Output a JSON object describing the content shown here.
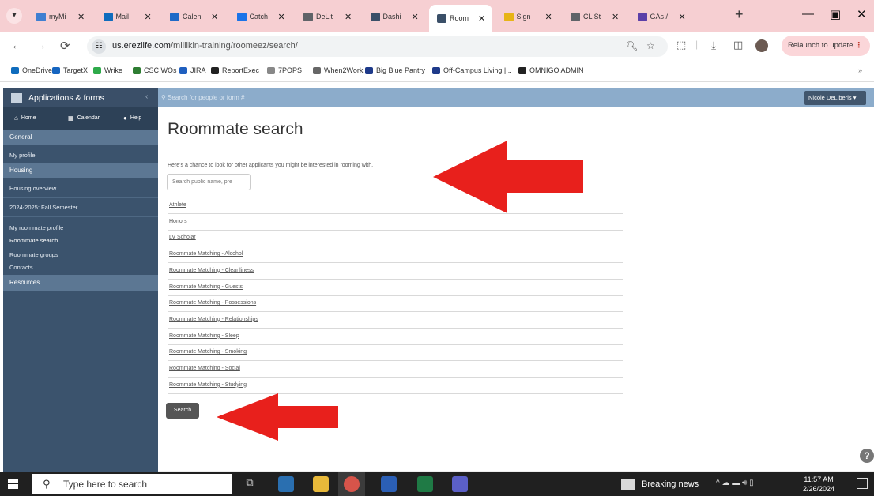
{
  "browser": {
    "tabs": [
      {
        "title": "myMi",
        "color": "#3f7fd1"
      },
      {
        "title": "Mail",
        "color": "#0f6cbd"
      },
      {
        "title": "Calen",
        "color": "#1e69c7"
      },
      {
        "title": "Catch",
        "color": "#1a73e8"
      },
      {
        "title": "DeLit",
        "color": "#5f6368"
      },
      {
        "title": "Dashi",
        "color": "#3a4f68"
      },
      {
        "title": "Room",
        "color": "#3a4f68",
        "active": true
      },
      {
        "title": "Sign",
        "color": "#e7b416"
      },
      {
        "title": "CL St",
        "color": "#5f6368"
      },
      {
        "title": "GAs /",
        "color": "#5b3fa8"
      }
    ],
    "url_domain": "us.erezlife.com",
    "url_path": "/millikin-training/roomeez/search/",
    "relaunch_label": "Relaunch to update",
    "bookmarks": [
      {
        "label": "OneDrive",
        "color": "#0f6cbd"
      },
      {
        "label": "TargetX",
        "color": "#1565c0"
      },
      {
        "label": "Wrike",
        "color": "#2eaa4a"
      },
      {
        "label": "CSC WOs",
        "color": "#2e7d32"
      },
      {
        "label": "JIRA",
        "color": "#1f5fbf"
      },
      {
        "label": "ReportExec",
        "color": "#222222"
      },
      {
        "label": "7POPS",
        "color": "#888888"
      },
      {
        "label": "When2Work",
        "color": "#666666"
      },
      {
        "label": "Big Blue Pantry",
        "color": "#1e3a8a"
      },
      {
        "label": "Off-Campus Living |...",
        "color": "#1e3a8a"
      },
      {
        "label": "OMNIGO ADMIN",
        "color": "#222222"
      }
    ]
  },
  "app": {
    "title": "Applications & forms",
    "people_search_placeholder": "Search for people or form #",
    "user_label": "Nicole DeLiberis",
    "nav": {
      "home": "Home",
      "calendar": "Calendar",
      "help": "Help"
    }
  },
  "sidebar": {
    "sections": {
      "general": "General",
      "housing": "Housing",
      "resources": "Resources"
    },
    "items": {
      "my_profile": "My profile",
      "housing_overview": "Housing overview",
      "fall_semester": "2024-2025: Fall Semester",
      "my_roommate_profile": "My roommate profile",
      "roommate_search": "Roommate search",
      "roommate_groups": "Roommate groups",
      "contacts": "Contacts"
    }
  },
  "main": {
    "title": "Roommate search",
    "intro": "Here's a chance to look for other applicants you might be interested in rooming with.",
    "search_placeholder": "Search public name, pre",
    "options": [
      "Athlete",
      "Honors",
      "LV Scholar",
      "Roommate Matching - Alcohol",
      "Roommate Matching - Cleanliness",
      "Roommate Matching - Guests",
      "Roommate Matching - Possessions",
      "Roommate Matching - Relationships",
      "Roommate Matching - Sleep",
      "Roommate Matching - Smoking",
      "Roommate Matching - Social",
      "Roommate Matching - Studying"
    ],
    "search_button": "Search"
  },
  "taskbar": {
    "search_placeholder": "Type here to search",
    "news": "Breaking news",
    "time": "11:57 AM",
    "date": "2/26/2024"
  },
  "colors": {
    "annotation_arrow": "#e8201c",
    "sidebar": "#3b536d",
    "header": "#8caccb"
  }
}
